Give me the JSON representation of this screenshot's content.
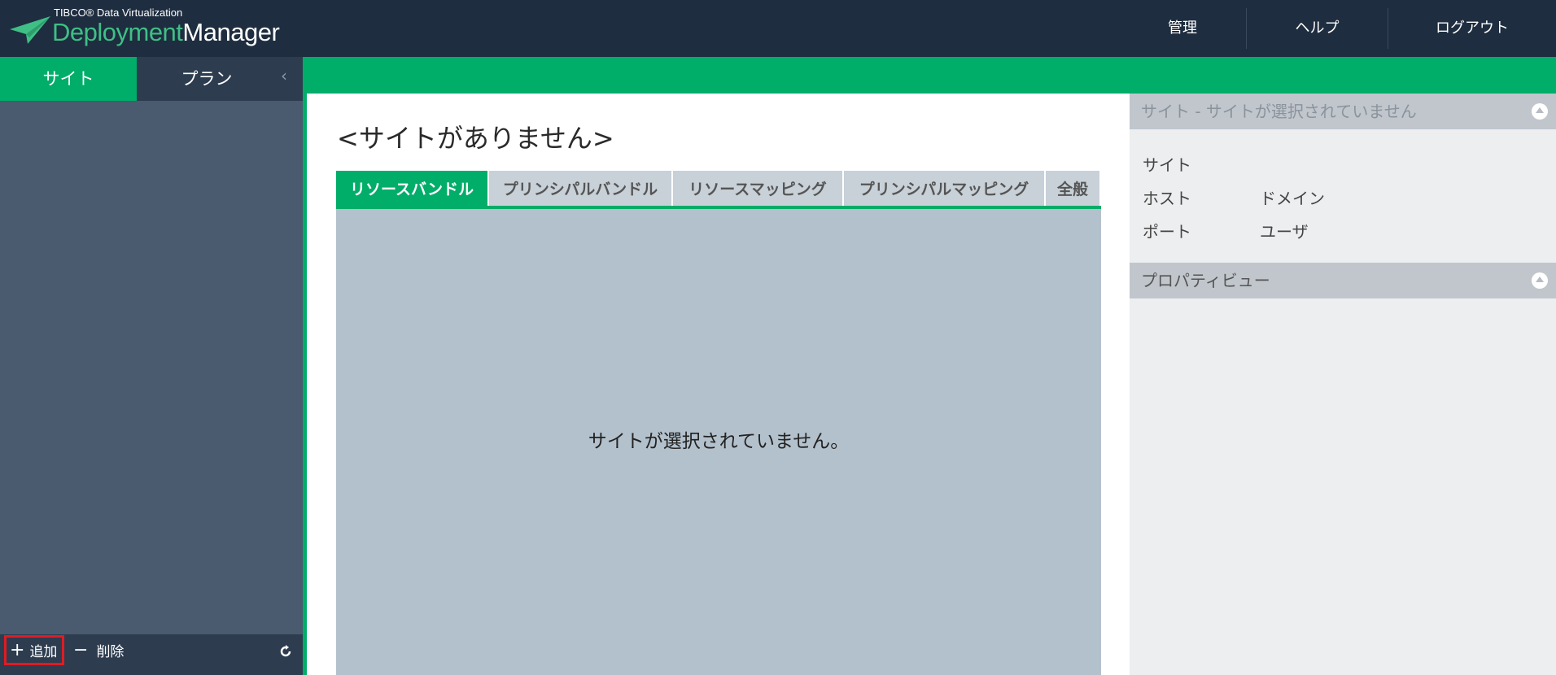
{
  "header": {
    "brand_small": "TIBCO® Data Virtualization",
    "brand_part1": "Deployment",
    "brand_part2": "Manager",
    "nav": {
      "admin": "管理",
      "help": "ヘルプ",
      "logout": "ログアウト"
    }
  },
  "sidebar": {
    "tabs": {
      "site": "サイト",
      "plan": "プラン"
    },
    "collapse_glyph": "‹",
    "footer": {
      "add_label": "追加",
      "delete_label": "削除"
    }
  },
  "main": {
    "title": "<サイトがありません>",
    "tabs": [
      "リソースバンドル",
      "プリンシパルバンドル",
      "リソースマッピング",
      "プリンシパルマッピング",
      "全般"
    ],
    "active_tab": "リソースバンドル",
    "empty_message": "サイトが選択されていません。"
  },
  "details": {
    "site_panel_title": "サイト - サイトが選択されていません",
    "site_label": "サイト",
    "host_label": "ホスト",
    "port_label": "ポート",
    "domain_label": "ドメイン",
    "user_label": "ユーザ",
    "property_view_title": "プロパティビュー"
  },
  "colors": {
    "header_bg": "#1e2d3f",
    "accent_green": "#00ad69",
    "sidebar_bg": "#4a5a6f",
    "content_bg": "#b3c1cc",
    "highlight_red": "#e01b24"
  },
  "icons": [
    "logo-paper-plane-icon",
    "collapse-chevron-icon",
    "plus-icon",
    "minus-icon",
    "refresh-icon",
    "collapse-circle-icon"
  ]
}
